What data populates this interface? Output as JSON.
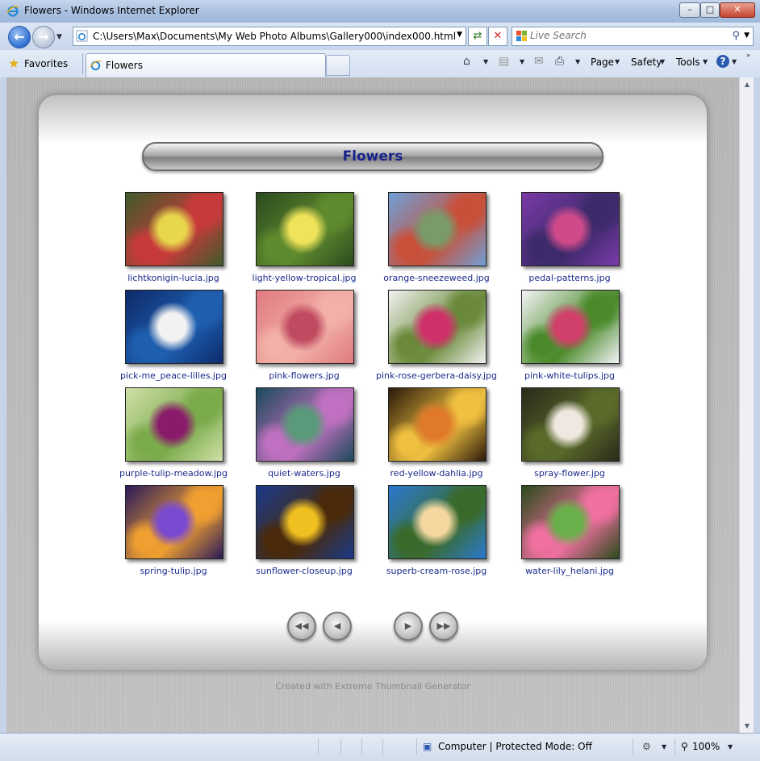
{
  "window": {
    "title": "Flowers - Windows Internet Explorer",
    "buttons": {
      "minimize": "–",
      "maximize": "□",
      "close": "✕"
    }
  },
  "address_bar": {
    "url": "C:\\Users\\Max\\Documents\\My Web Photo Albums\\Gallery000\\index000.html",
    "search_placeholder": "Live Search"
  },
  "tabs": {
    "favorites_label": "Favorites",
    "active_tab_label": "Flowers"
  },
  "commands": {
    "page": "Page",
    "safety": "Safety",
    "tools": "Tools",
    "help": "?"
  },
  "gallery": {
    "title": "Flowers",
    "thumbnails": [
      {
        "caption": "lichtkonigin-lucia.jpg",
        "colors": [
          "#3e5b2a",
          "#e8d64c",
          "#c83a3a"
        ]
      },
      {
        "caption": "light-yellow-tropical.jpg",
        "colors": [
          "#2b4a1e",
          "#f0e35a",
          "#5f8a2e"
        ]
      },
      {
        "caption": "orange-sneezeweed.jpg",
        "colors": [
          "#6fa0d8",
          "#7a9a6a",
          "#c8503a"
        ]
      },
      {
        "caption": "pedal-patterns.jpg",
        "colors": [
          "#7a3aa8",
          "#d04a8a",
          "#3c2a6a"
        ]
      },
      {
        "caption": "pick-me_peace-lilies.jpg",
        "colors": [
          "#0d2a6a",
          "#f2f2f2",
          "#1f5fb0"
        ]
      },
      {
        "caption": "pink-flowers.jpg",
        "colors": [
          "#e07a80",
          "#c04a60",
          "#f2b0a8"
        ]
      },
      {
        "caption": "pink-rose-gerbera-daisy.jpg",
        "colors": [
          "#f2f2f2",
          "#d0306a",
          "#6a8a3a"
        ]
      },
      {
        "caption": "pink-white-tulips.jpg",
        "colors": [
          "#f4f4f8",
          "#d0406a",
          "#4a8a2a"
        ]
      },
      {
        "caption": "purple-tulip-meadow.jpg",
        "colors": [
          "#cfe0a8",
          "#8a1a6a",
          "#7aaa4a"
        ]
      },
      {
        "caption": "quiet-waters.jpg",
        "colors": [
          "#1a4a5a",
          "#5a9a7a",
          "#c070c0"
        ]
      },
      {
        "caption": "red-yellow-dahlia.jpg",
        "colors": [
          "#2a1a0a",
          "#e07a2a",
          "#f0c040"
        ]
      },
      {
        "caption": "spray-flower.jpg",
        "colors": [
          "#2a2a1a",
          "#f0e8e0",
          "#5a6a2a"
        ]
      },
      {
        "caption": "spring-tulip.jpg",
        "colors": [
          "#2a1a5a",
          "#7a4ad0",
          "#f0a030"
        ]
      },
      {
        "caption": "sunflower-closeup.jpg",
        "colors": [
          "#1a3a8a",
          "#f0c020",
          "#4a2a0a"
        ]
      },
      {
        "caption": "superb-cream-rose.jpg",
        "colors": [
          "#2a7ad0",
          "#f4d8a0",
          "#3a6a2a"
        ]
      },
      {
        "caption": "water-lily_helani.jpg",
        "colors": [
          "#2a4a1a",
          "#6ab04a",
          "#f070a0"
        ]
      }
    ],
    "nav": {
      "first": "◀◀",
      "prev": "◀",
      "next": "▶",
      "last": "▶▶"
    },
    "footer": "Created with Extreme Thumbnail Generator"
  },
  "status": {
    "zone": "Computer | Protected Mode: Off",
    "zoom": "100%"
  },
  "icons": {
    "back": "back-arrow-icon",
    "forward": "forward-arrow-icon",
    "refresh": "refresh-icon",
    "stop": "stop-icon",
    "search": "search-icon",
    "home": "home-icon",
    "feeds": "rss-icon",
    "mail": "mail-icon",
    "print": "print-icon",
    "help": "help-icon"
  }
}
